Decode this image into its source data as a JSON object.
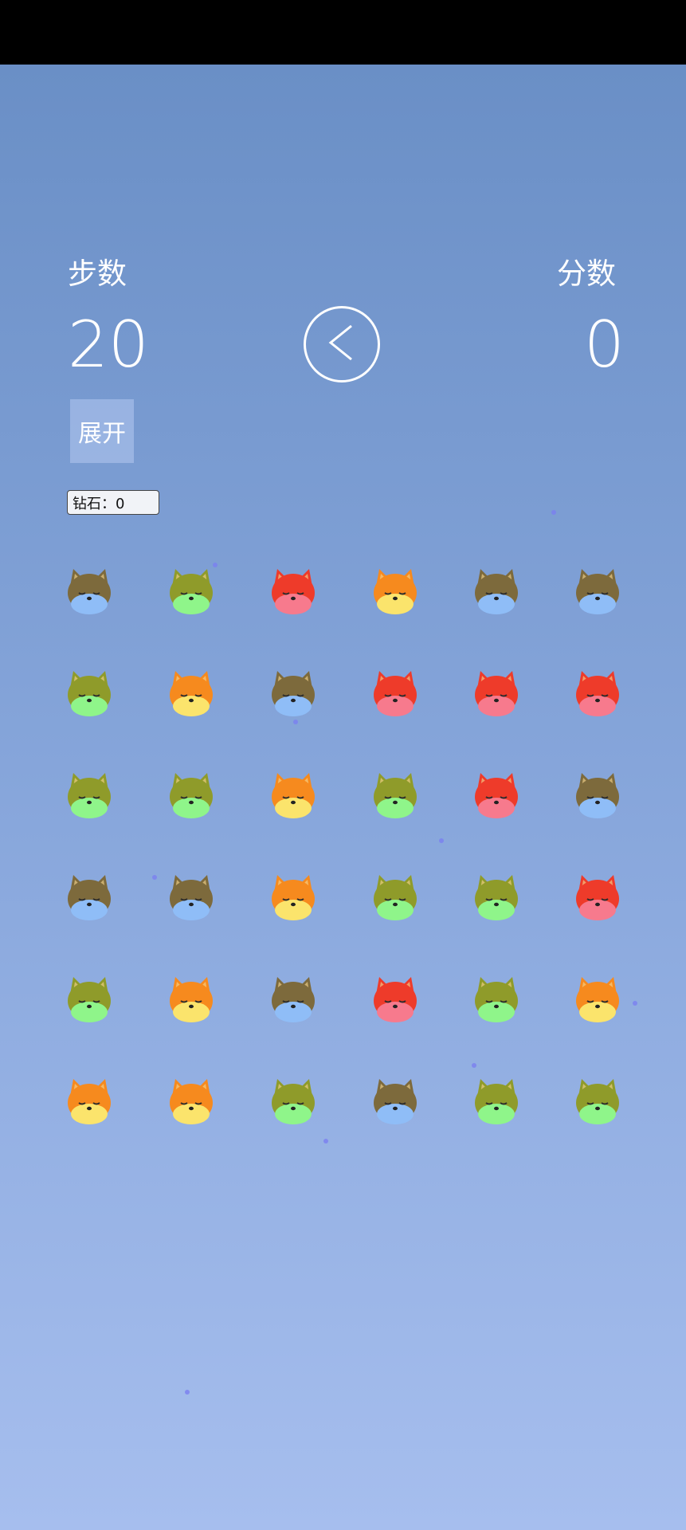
{
  "hud": {
    "steps_label": "步数",
    "steps_value": "20",
    "score_label": "分数",
    "score_value": "0",
    "expand_label": "展开",
    "diamond_text": "钻石：0"
  },
  "icons": {
    "back": "chevron-left-icon"
  },
  "palette": {
    "brown": {
      "body": "#7d6a3c",
      "face": "#8fbdf7"
    },
    "olive": {
      "body": "#8f9b2a",
      "face": "#8ff58a"
    },
    "red": {
      "body": "#ee3b2a",
      "face": "#f77a8d"
    },
    "orange": {
      "body": "#f68a1e",
      "face": "#fbe46c"
    }
  },
  "board": [
    [
      "brown",
      "olive",
      "red",
      "orange",
      "brown",
      "brown"
    ],
    [
      "olive",
      "orange",
      "brown",
      "red",
      "red",
      "red"
    ],
    [
      "olive",
      "olive",
      "orange",
      "olive",
      "red",
      "brown"
    ],
    [
      "brown",
      "brown",
      "orange",
      "olive",
      "olive",
      "red"
    ],
    [
      "olive",
      "orange",
      "brown",
      "red",
      "olive",
      "orange"
    ],
    [
      "orange",
      "orange",
      "olive",
      "brown",
      "olive",
      "olive"
    ]
  ]
}
